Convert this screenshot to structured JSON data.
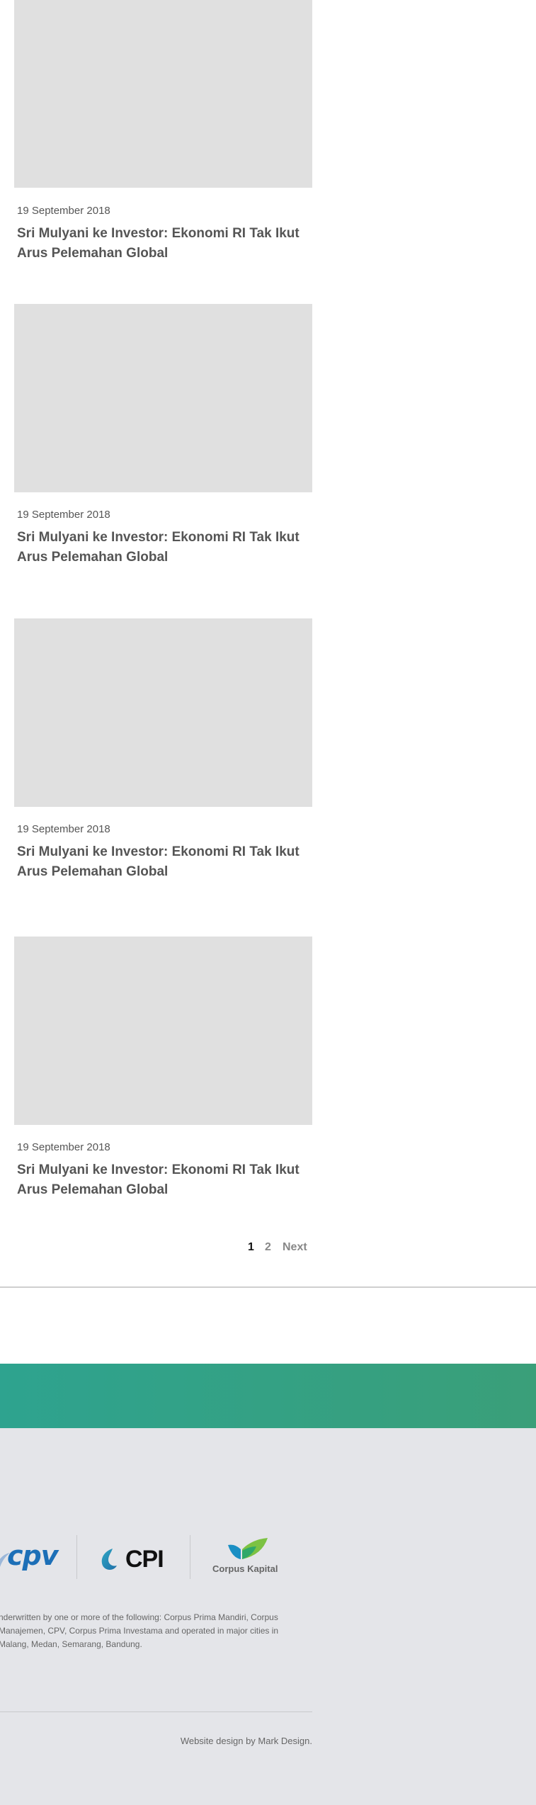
{
  "articles": [
    {
      "date": "19 September 2018",
      "title": "Sri Mulyani ke Investor: Ekonomi RI Tak Ikut Arus Pelemahan Global"
    },
    {
      "date": "19 September 2018",
      "title": "Sri Mulyani ke Investor: Ekonomi RI Tak Ikut Arus Pelemahan Global"
    },
    {
      "date": "19 September 2018",
      "title": "Sri Mulyani ke Investor: Ekonomi RI Tak Ikut Arus Pelemahan Global"
    },
    {
      "date": "19 September 2018",
      "title": "Sri Mulyani ke Investor: Ekonomi RI Tak Ikut Arus Pelemahan Global"
    }
  ],
  "pagination": {
    "page_1": "1",
    "page_2": "2",
    "next": "Next"
  },
  "footer": {
    "logos": {
      "cpv": "cpv",
      "cpi": "CPI",
      "kapital": "Corpus Kapital"
    },
    "disclaimer": "nderwritten by one or more of the following: Corpus Prima Mandiri, Corpus\n Manajemen, CPV, Corpus Prima Investama and operated in major cities in\nMalang, Medan, Semarang, Bandung.",
    "credit": "Website design by Mark Design."
  },
  "colors": {
    "band_start": "#2ea38f",
    "band_end": "#3a9f79",
    "footer_bg": "#e4e5e9",
    "placeholder": "#e0e0e0"
  }
}
